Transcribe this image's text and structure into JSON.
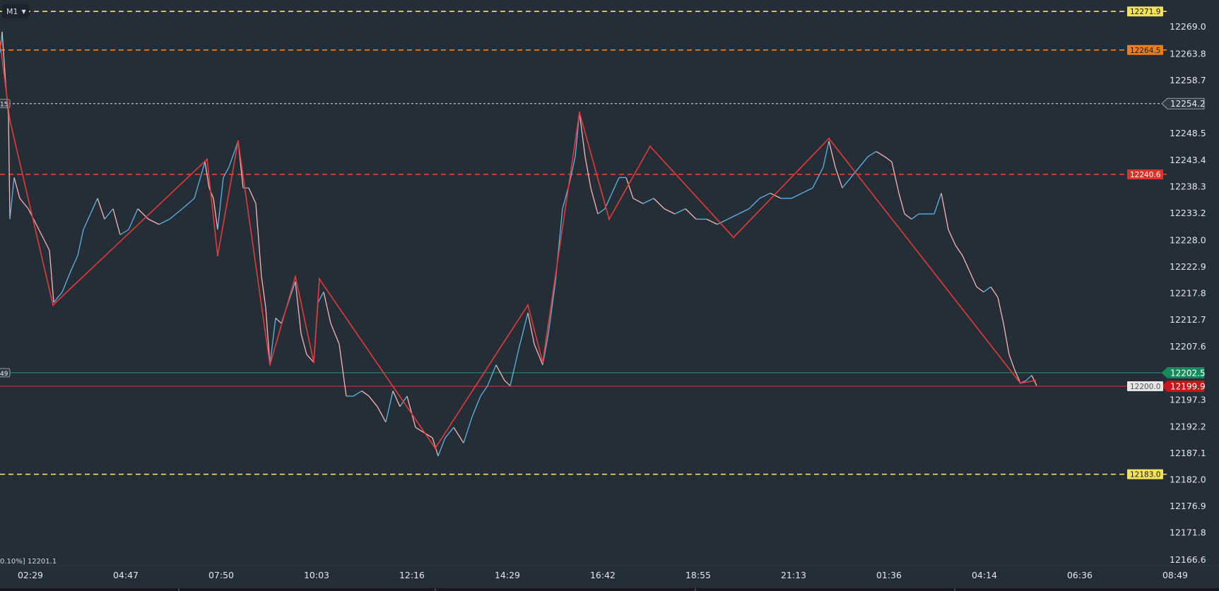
{
  "toolbar": {
    "timeframe": "M1"
  },
  "info_text": "0.10%] 12201.1",
  "left_tags": [
    "15",
    "49"
  ],
  "colors": {
    "background": "#252d36",
    "up_candle": "#5bb6e8",
    "down_candle": "#f5b7b7",
    "zigzag": "#e23b3b",
    "axis_text": "#e3e6ea"
  },
  "chart_data": {
    "type": "line",
    "instrument_timeframe": "M1",
    "y_axis": {
      "ticks": [
        12269.0,
        12263.8,
        12258.7,
        12248.5,
        12243.4,
        12238.3,
        12233.2,
        12228.0,
        12222.9,
        12217.8,
        12212.7,
        12207.6,
        12197.3,
        12192.2,
        12187.1,
        12182.0,
        12176.9,
        12171.8,
        12166.6
      ],
      "range": [
        12164.6,
        12274.1
      ]
    },
    "x_axis": {
      "ticks": [
        "02:29",
        "04:47",
        "07:50",
        "10:03",
        "12:16",
        "14:29",
        "16:42",
        "18:55",
        "21:13",
        "01:36",
        "04:14",
        "06:36",
        "08:49"
      ]
    },
    "horizontal_levels": [
      {
        "value": 12271.9,
        "label": "12271.9",
        "color": "#f3e15b",
        "style": "dashed",
        "label_bg": "#f3e15b",
        "label_fg": "#1a1a1a"
      },
      {
        "value": 12264.5,
        "label": "12264.5",
        "color": "#f08a24",
        "style": "dashed",
        "label_bg": "#f07d12",
        "label_fg": "#1a1a1a"
      },
      {
        "value": 12240.6,
        "label": "12240.6",
        "color": "#e0453c",
        "style": "dashed",
        "label_bg": "#d8352c",
        "label_fg": "#ffffff"
      },
      {
        "value": 12183.0,
        "label": "12183.0",
        "color": "#f3e15b",
        "style": "dashed",
        "label_bg": "#f3e15b",
        "label_fg": "#1a1a1a"
      },
      {
        "value": 12254.2,
        "label": "12254.2",
        "color": "#dfe4ea",
        "style": "dotted",
        "label_bg": "#2f3a45",
        "label_fg": "#e8ecef",
        "axis_marker": true
      },
      {
        "value": 12202.5,
        "label": "12202.5",
        "color": "#169e6e",
        "style": "solid",
        "label_bg": "#148a5e",
        "label_fg": "#ffffff",
        "axis_marker": true
      },
      {
        "value": 12199.9,
        "label": "12199.9",
        "color": "#d83232",
        "style": "solid",
        "label_bg": "#c8151b",
        "label_fg": "#ffffff",
        "axis_marker": true
      }
    ],
    "extra_labels": [
      {
        "value": 12199.9,
        "label": "12200.0",
        "label_bg": "#e6e6e6",
        "label_fg": "#555555"
      }
    ],
    "zigzag": [
      [
        0,
        12266.0
      ],
      [
        14,
        12251.0
      ],
      [
        75,
        12215.5
      ],
      [
        293,
        12243.5
      ],
      [
        308,
        12225.0
      ],
      [
        337,
        12247.0
      ],
      [
        382,
        12204.0
      ],
      [
        418,
        12221.0
      ],
      [
        444,
        12204.5
      ],
      [
        452,
        12220.5
      ],
      [
        616,
        12188.0
      ],
      [
        747,
        12215.5
      ],
      [
        768,
        12204.5
      ],
      [
        820,
        12252.5
      ],
      [
        862,
        12232.0
      ],
      [
        920,
        12246.0
      ],
      [
        1038,
        12228.5
      ],
      [
        1173,
        12247.5
      ],
      [
        1444,
        12200.5
      ],
      [
        1465,
        12201.0
      ]
    ],
    "price_path": [
      [
        0,
        12264.0
      ],
      [
        3,
        12268.0
      ],
      [
        8,
        12258.0
      ],
      [
        12,
        12252.0
      ],
      [
        14,
        12232.0
      ],
      [
        20,
        12240.0
      ],
      [
        28,
        12236.0
      ],
      [
        40,
        12234.0
      ],
      [
        55,
        12230.0
      ],
      [
        70,
        12226.0
      ],
      [
        76,
        12216.0
      ],
      [
        88,
        12218.0
      ],
      [
        100,
        12222.0
      ],
      [
        110,
        12225.0
      ],
      [
        118,
        12230.0
      ],
      [
        128,
        12233.0
      ],
      [
        138,
        12236.0
      ],
      [
        148,
        12232.0
      ],
      [
        160,
        12234.0
      ],
      [
        170,
        12229.0
      ],
      [
        182,
        12230.0
      ],
      [
        195,
        12234.0
      ],
      [
        210,
        12232.0
      ],
      [
        225,
        12231.0
      ],
      [
        240,
        12232.0
      ],
      [
        258,
        12234.0
      ],
      [
        275,
        12236.0
      ],
      [
        290,
        12243.0
      ],
      [
        296,
        12238.0
      ],
      [
        302,
        12236.0
      ],
      [
        308,
        12230.0
      ],
      [
        316,
        12240.0
      ],
      [
        324,
        12242.0
      ],
      [
        337,
        12247.0
      ],
      [
        344,
        12238.0
      ],
      [
        352,
        12238.0
      ],
      [
        362,
        12235.0
      ],
      [
        370,
        12221.0
      ],
      [
        376,
        12215.0
      ],
      [
        382,
        12204.0
      ],
      [
        390,
        12213.0
      ],
      [
        398,
        12212.0
      ],
      [
        408,
        12216.0
      ],
      [
        418,
        12220.0
      ],
      [
        426,
        12210.0
      ],
      [
        434,
        12206.0
      ],
      [
        444,
        12204.5
      ],
      [
        450,
        12216.0
      ],
      [
        458,
        12218.0
      ],
      [
        468,
        12212.0
      ],
      [
        480,
        12208.0
      ],
      [
        490,
        12198.0
      ],
      [
        500,
        12198.0
      ],
      [
        512,
        12199.0
      ],
      [
        522,
        12198.0
      ],
      [
        534,
        12196.0
      ],
      [
        546,
        12193.0
      ],
      [
        556,
        12199.0
      ],
      [
        566,
        12196.0
      ],
      [
        576,
        12198.0
      ],
      [
        588,
        12192.0
      ],
      [
        600,
        12191.0
      ],
      [
        612,
        12190.0
      ],
      [
        620,
        12186.5
      ],
      [
        630,
        12190.0
      ],
      [
        642,
        12192.0
      ],
      [
        656,
        12189.0
      ],
      [
        668,
        12194.0
      ],
      [
        680,
        12198.0
      ],
      [
        690,
        12200.0
      ],
      [
        702,
        12204.0
      ],
      [
        714,
        12201.0
      ],
      [
        722,
        12200.0
      ],
      [
        734,
        12207.0
      ],
      [
        747,
        12214.0
      ],
      [
        756,
        12208.0
      ],
      [
        768,
        12204.0
      ],
      [
        776,
        12210.0
      ],
      [
        786,
        12220.0
      ],
      [
        796,
        12234.0
      ],
      [
        806,
        12239.0
      ],
      [
        814,
        12244.0
      ],
      [
        820,
        12252.5
      ],
      [
        828,
        12244.0
      ],
      [
        836,
        12238.0
      ],
      [
        846,
        12233.0
      ],
      [
        856,
        12234.0
      ],
      [
        866,
        12237.0
      ],
      [
        876,
        12240.0
      ],
      [
        886,
        12240.0
      ],
      [
        896,
        12236.0
      ],
      [
        910,
        12235.0
      ],
      [
        925,
        12236.0
      ],
      [
        940,
        12234.0
      ],
      [
        955,
        12233.0
      ],
      [
        970,
        12234.0
      ],
      [
        985,
        12232.0
      ],
      [
        1000,
        12232.0
      ],
      [
        1015,
        12231.0
      ],
      [
        1030,
        12232.0
      ],
      [
        1045,
        12233.0
      ],
      [
        1060,
        12234.0
      ],
      [
        1075,
        12236.0
      ],
      [
        1090,
        12237.0
      ],
      [
        1105,
        12236.0
      ],
      [
        1120,
        12236.0
      ],
      [
        1135,
        12237.0
      ],
      [
        1150,
        12238.0
      ],
      [
        1165,
        12242.0
      ],
      [
        1173,
        12247.0
      ],
      [
        1182,
        12242.0
      ],
      [
        1192,
        12238.0
      ],
      [
        1204,
        12240.0
      ],
      [
        1216,
        12242.0
      ],
      [
        1228,
        12244.0
      ],
      [
        1240,
        12245.0
      ],
      [
        1252,
        12244.0
      ],
      [
        1262,
        12243.0
      ],
      [
        1272,
        12237.0
      ],
      [
        1280,
        12233.0
      ],
      [
        1290,
        12232.0
      ],
      [
        1300,
        12233.0
      ],
      [
        1312,
        12233.0
      ],
      [
        1322,
        12233.0
      ],
      [
        1332,
        12237.0
      ],
      [
        1342,
        12230.0
      ],
      [
        1352,
        12227.0
      ],
      [
        1362,
        12225.0
      ],
      [
        1372,
        12222.0
      ],
      [
        1382,
        12219.0
      ],
      [
        1392,
        12218.0
      ],
      [
        1402,
        12219.0
      ],
      [
        1412,
        12217.0
      ],
      [
        1420,
        12212.0
      ],
      [
        1428,
        12206.0
      ],
      [
        1436,
        12203.0
      ],
      [
        1444,
        12200.5
      ],
      [
        1452,
        12201.0
      ],
      [
        1460,
        12202.0
      ],
      [
        1467,
        12200.0
      ]
    ]
  }
}
